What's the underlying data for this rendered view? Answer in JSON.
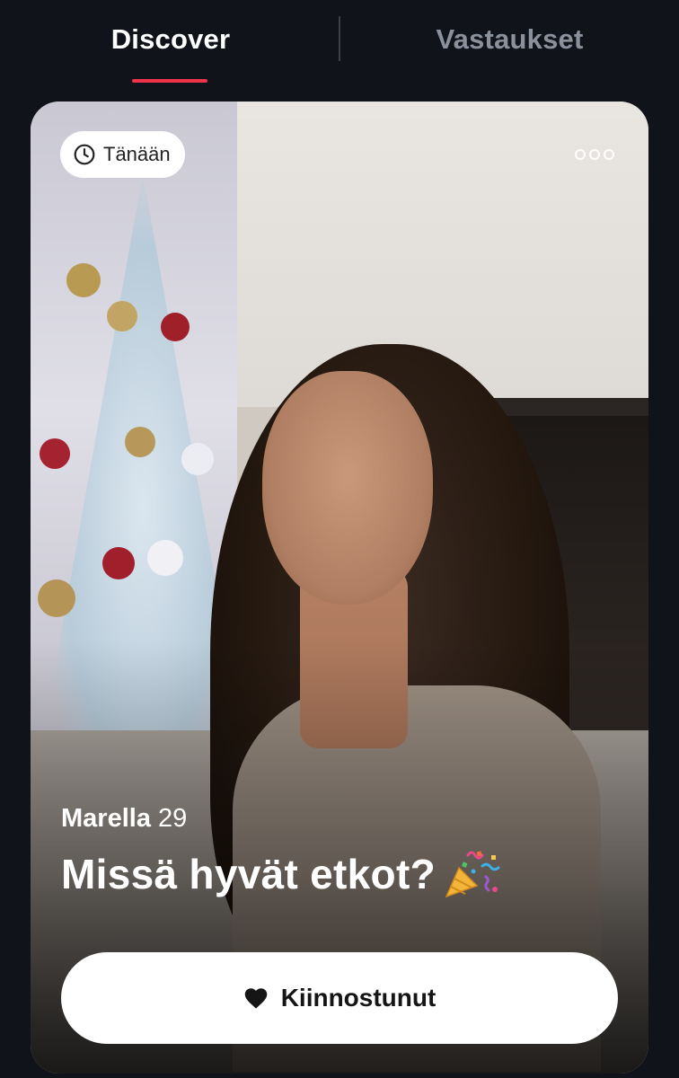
{
  "tabs": {
    "discover": "Discover",
    "answers": "Vastaukset",
    "active": "discover",
    "accent_color": "#f0334a"
  },
  "card": {
    "time_badge": {
      "icon": "clock-icon",
      "label": "Tänään"
    },
    "more_icon": "more-dots-icon",
    "profile": {
      "name": "Marella",
      "age": "29"
    },
    "question": {
      "text": "Missä hyvät etkot?",
      "icon": "party-popper-icon"
    },
    "action": {
      "icon": "heart-icon",
      "label": "Kiinnostunut"
    }
  }
}
